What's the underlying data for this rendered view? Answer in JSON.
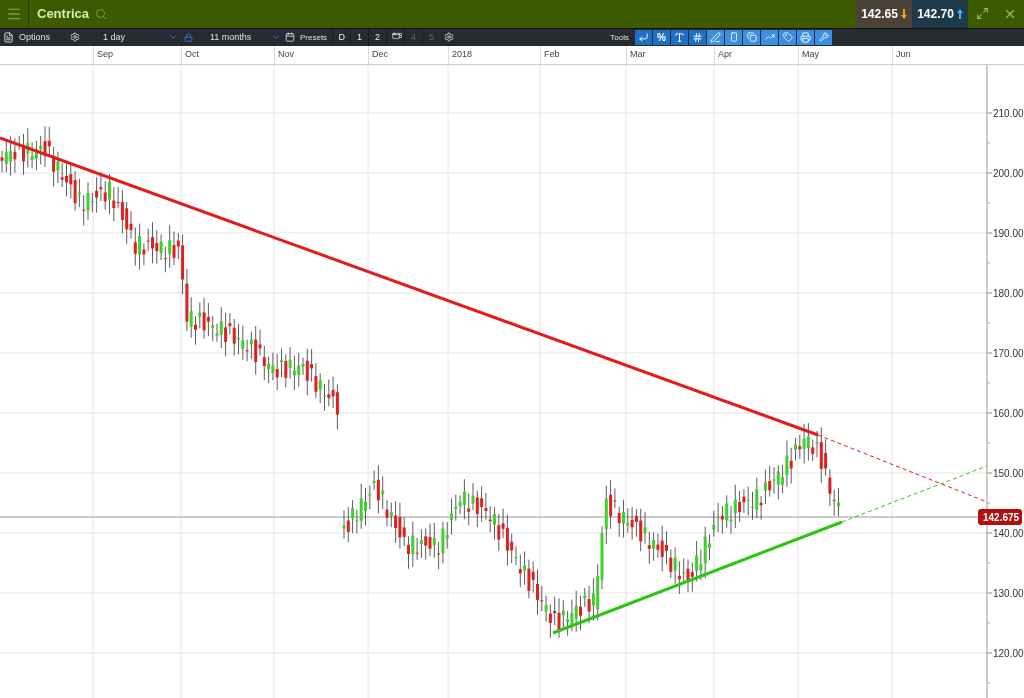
{
  "header": {
    "title": "Centrica",
    "bid": "142.65",
    "ask": "142.70"
  },
  "toolbar": {
    "options": "Options",
    "interval": "1 day",
    "range": "11 months",
    "presets_label": "Presets",
    "presets": [
      {
        "label": "D",
        "disabled": false
      },
      {
        "label": "1",
        "disabled": false
      },
      {
        "label": "2",
        "disabled": false
      },
      {
        "label": "3",
        "kind": "window",
        "disabled": false
      },
      {
        "label": "4",
        "disabled": true
      },
      {
        "label": "5",
        "disabled": true
      }
    ],
    "tools_label": "Tools",
    "percent": "%"
  },
  "time_axis": [
    "Sep",
    "Oct",
    "Nov",
    "Dec",
    "2018",
    "Feb",
    "Mar",
    "Apr",
    "May",
    "Jun"
  ],
  "price_axis": [
    "210.00",
    "200.00",
    "190.00",
    "180.00",
    "170.00",
    "160.00",
    "150.00",
    "140.00",
    "130.00",
    "120.00"
  ],
  "last_price": "142.675"
}
